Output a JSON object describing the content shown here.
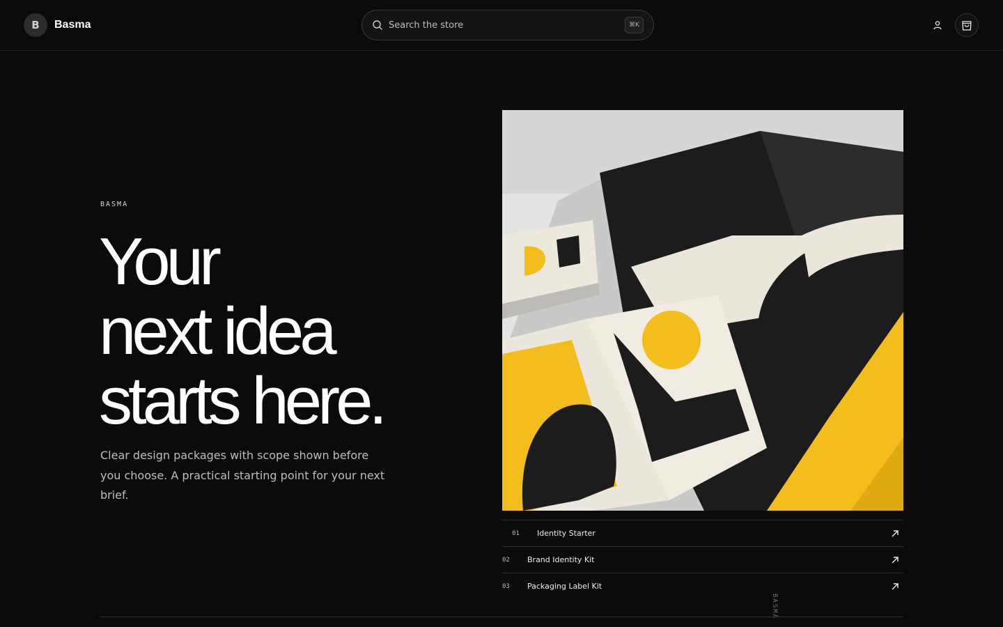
{
  "header": {
    "logo_letter": "B",
    "brand_name": "Basma",
    "search_placeholder": "Search the store",
    "search_shortcut": "⌘K",
    "account_icon": "user-icon",
    "cart_icon": "shopping-bag-icon"
  },
  "hero": {
    "eyebrow": "BASMA",
    "headline_lines": [
      "Your",
      "next idea",
      "starts here."
    ],
    "lede": "Clear design packages with scope shown before you choose. A practical starting point for your next brief."
  },
  "packages": [
    {
      "number": "01",
      "name": "Identity Starter"
    },
    {
      "number": "02",
      "name": "Brand Identity Kit"
    },
    {
      "number": "03",
      "name": "Packaging Label Kit"
    }
  ],
  "vertical_label": "BASMA",
  "colors": {
    "background": "#0b0b0b",
    "accent_yellow": "#f2bd1d",
    "ink": "#1b1b1b",
    "paper": "#ece7dc"
  }
}
